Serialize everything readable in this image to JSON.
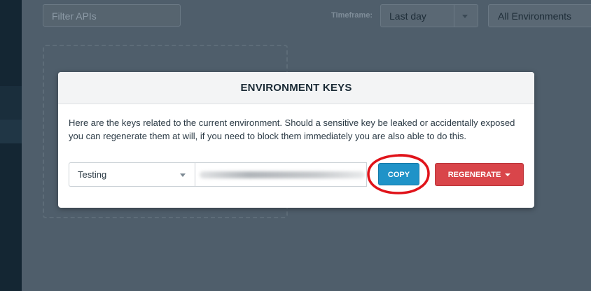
{
  "toolbar": {
    "filter_placeholder": "Filter APIs",
    "timeframe_label": "Timeframe:",
    "timeframe_value": "Last day",
    "environment_value": "All Environments"
  },
  "modal": {
    "title": "ENVIRONMENT KEYS",
    "description": "Here are the keys related to the current environment. Should a sensitive key be leaked or accidentally exposed you can regenerate them at will, if you need to block them immediately you are also able to do this.",
    "environment_selected": "Testing",
    "copy_label": "COPY",
    "regenerate_label": "REGENERATE"
  },
  "annotation": {
    "color": "#e0131a"
  }
}
